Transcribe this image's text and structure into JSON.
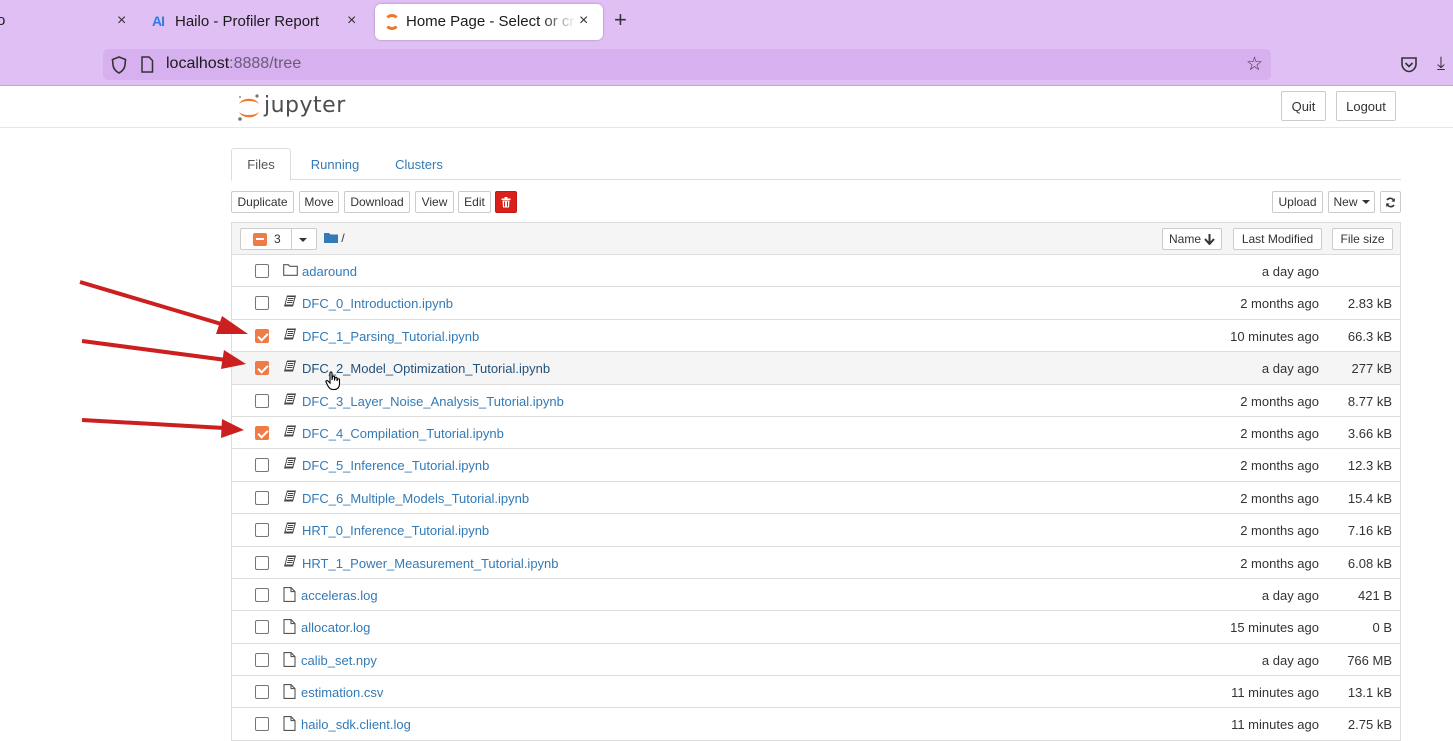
{
  "browser": {
    "tabs": [
      {
        "label": "",
        "fragment": "o",
        "close": "×"
      },
      {
        "label": "Hailo - Profiler Report",
        "favicon": "AI",
        "close": "×"
      },
      {
        "label": "Home Page - Select or create",
        "close": "×",
        "active": true
      }
    ],
    "new_tab": "+",
    "url_host": "localhost",
    "url_rest": ":8888/tree"
  },
  "jupyter": {
    "logo_text": "jupyter",
    "quit_label": "Quit",
    "logout_label": "Logout",
    "tabs": [
      "Files",
      "Running",
      "Clusters"
    ],
    "toolbar": {
      "duplicate": "Duplicate",
      "move": "Move",
      "download": "Download",
      "view": "View",
      "edit": "Edit",
      "upload": "Upload",
      "new": "New"
    },
    "list_header": {
      "selected_count": "3",
      "path": "/",
      "name": "Name",
      "last_modified": "Last Modified",
      "file_size": "File size"
    },
    "files": [
      {
        "name": "adaround",
        "type": "folder",
        "modified": "a day ago",
        "size": "",
        "checked": false
      },
      {
        "name": "DFC_0_Introduction.ipynb",
        "type": "notebook",
        "modified": "2 months ago",
        "size": "2.83 kB",
        "checked": false
      },
      {
        "name": "DFC_1_Parsing_Tutorial.ipynb",
        "type": "notebook",
        "modified": "10 minutes ago",
        "size": "66.3 kB",
        "checked": true
      },
      {
        "name": "DFC_2_Model_Optimization_Tutorial.ipynb",
        "type": "notebook",
        "modified": "a day ago",
        "size": "277 kB",
        "checked": true
      },
      {
        "name": "DFC_3_Layer_Noise_Analysis_Tutorial.ipynb",
        "type": "notebook",
        "modified": "2 months ago",
        "size": "8.77 kB",
        "checked": false
      },
      {
        "name": "DFC_4_Compilation_Tutorial.ipynb",
        "type": "notebook",
        "modified": "2 months ago",
        "size": "3.66 kB",
        "checked": true
      },
      {
        "name": "DFC_5_Inference_Tutorial.ipynb",
        "type": "notebook",
        "modified": "2 months ago",
        "size": "12.3 kB",
        "checked": false
      },
      {
        "name": "DFC_6_Multiple_Models_Tutorial.ipynb",
        "type": "notebook",
        "modified": "2 months ago",
        "size": "15.4 kB",
        "checked": false
      },
      {
        "name": "HRT_0_Inference_Tutorial.ipynb",
        "type": "notebook",
        "modified": "2 months ago",
        "size": "7.16 kB",
        "checked": false
      },
      {
        "name": "HRT_1_Power_Measurement_Tutorial.ipynb",
        "type": "notebook",
        "modified": "2 months ago",
        "size": "6.08 kB",
        "checked": false
      },
      {
        "name": "acceleras.log",
        "type": "file",
        "modified": "a day ago",
        "size": "421 B",
        "checked": false
      },
      {
        "name": "allocator.log",
        "type": "file",
        "modified": "15 minutes ago",
        "size": "0 B",
        "checked": false
      },
      {
        "name": "calib_set.npy",
        "type": "file",
        "modified": "a day ago",
        "size": "766 MB",
        "checked": false
      },
      {
        "name": "estimation.csv",
        "type": "file",
        "modified": "11 minutes ago",
        "size": "13.1 kB",
        "checked": false
      },
      {
        "name": "hailo_sdk.client.log",
        "type": "file",
        "modified": "11 minutes ago",
        "size": "2.75 kB",
        "checked": false
      }
    ]
  },
  "colors": {
    "chrome": "#e0bff5",
    "link": "#337ab7",
    "checked": "#ef7c47",
    "delete": "#d9201a",
    "annotation_arrow": "#cc1f1f"
  }
}
